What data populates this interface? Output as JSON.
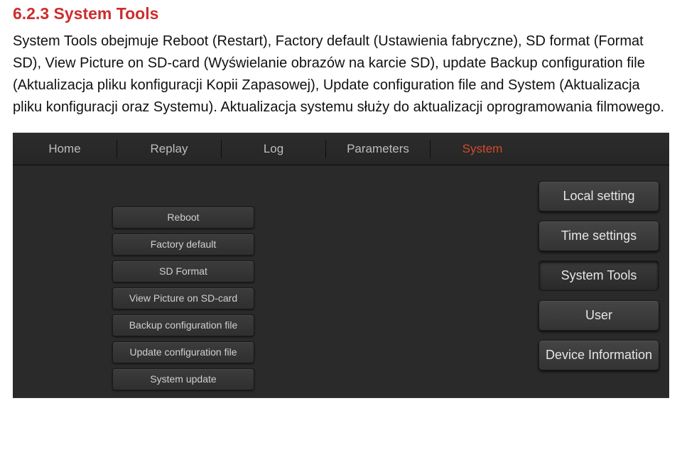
{
  "heading": "6.2.3 System Tools",
  "paragraph": "System Tools obejmuje Reboot (Restart), Factory default (Ustawienia fabryczne), SD format (Format SD), View Picture on SD-card (Wyświelanie obrazów na karcie SD), update Backup configuration file (Aktualizacja pliku konfiguracji Kopii Zapasowej), Update configuration file and System (Aktualizacja pliku konfiguracji oraz Systemu). Aktualizacja systemu służy do aktualizacji oprogramowania filmowego.",
  "nav": {
    "home": "Home",
    "replay": "Replay",
    "log": "Log",
    "parameters": "Parameters",
    "system": "System"
  },
  "tools": {
    "reboot": "Reboot",
    "factory_default": "Factory default",
    "sd_format": "SD Format",
    "view_picture": "View Picture on SD-card",
    "backup_config": "Backup configuration file",
    "update_config": "Update configuration file",
    "system_update": "System update"
  },
  "side": {
    "local_setting": "Local setting",
    "time_settings": "Time settings",
    "system_tools": "System Tools",
    "user": "User",
    "device_info": "Device Information"
  }
}
